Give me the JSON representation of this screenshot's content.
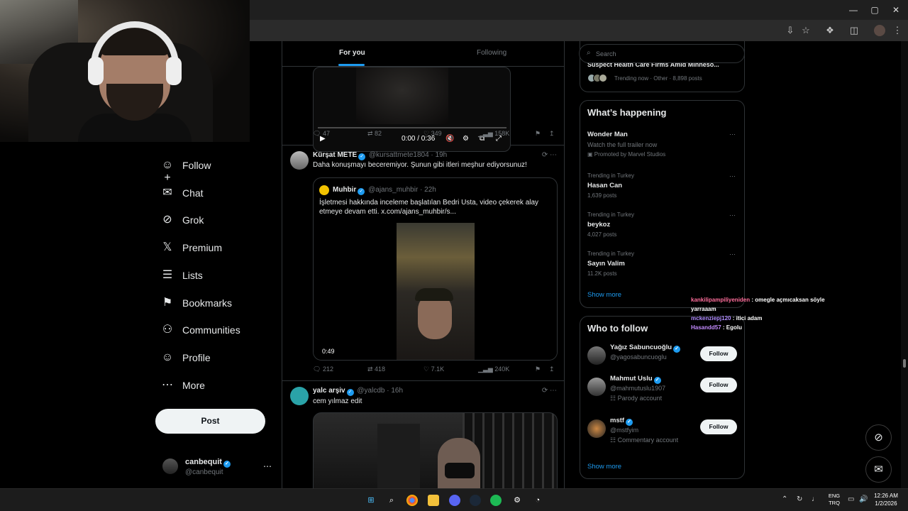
{
  "window": {
    "controls": [
      "—",
      "▢",
      "✕"
    ]
  },
  "nav": {
    "items": [
      {
        "label": "Follow",
        "icon": "follow-icon",
        "glyph": "☺+"
      },
      {
        "label": "Chat",
        "icon": "chat-icon",
        "glyph": "✉"
      },
      {
        "label": "Grok",
        "icon": "grok-icon",
        "glyph": "⊘"
      },
      {
        "label": "Premium",
        "icon": "x-logo-icon",
        "glyph": "𝕏"
      },
      {
        "label": "Lists",
        "icon": "lists-icon",
        "glyph": "☰"
      },
      {
        "label": "Bookmarks",
        "icon": "bookmark-icon",
        "glyph": "⚑"
      },
      {
        "label": "Communities",
        "icon": "communities-icon",
        "glyph": "⚇"
      },
      {
        "label": "Profile",
        "icon": "profile-icon",
        "glyph": "☺"
      },
      {
        "label": "More",
        "icon": "more-icon",
        "glyph": "⋯"
      }
    ],
    "post_label": "Post",
    "account": {
      "name": "canbequit",
      "handle": "@canbequit"
    }
  },
  "timeline": {
    "tabs": [
      "For you",
      "Following"
    ],
    "tweet1": {
      "video_time": "0:00 / 0:36",
      "replies": "47",
      "reposts": "82",
      "likes": "349",
      "views": "158K"
    },
    "tweet2": {
      "name": "Kürşat METE",
      "handle": "@kursattmete1804 · 19h",
      "text": "Daha konuşmayı beceremiyor. Şunun gibi itleri meşhur ediyorsunuz!",
      "quote": {
        "name": "Muhbir",
        "handle": "@ajans_muhbir · 22h",
        "text": "İşletmesi hakkında inceleme başlatılan Bedri Usta, video çekerek alay etmeye devam etti.  x.com/ajans_muhbir/s...",
        "duration": "0:49"
      },
      "replies": "212",
      "reposts": "418",
      "likes": "7.1K",
      "views": "240K"
    },
    "tweet3": {
      "name": "yalc arşiv",
      "handle": "@yalcdb · 16h",
      "text": "cem yılmaz edit"
    }
  },
  "right": {
    "search_placeholder": "Search",
    "top_trend": {
      "title": "Suspect Health Care Firms Amid Minneso...",
      "meta": "Trending now · Other · 8,898 posts"
    },
    "whats_happening": {
      "title": "What’s happening",
      "trends": [
        {
          "context": "",
          "name": "Wonder Man",
          "sub": "Watch the full trailer now",
          "promo": "Promoted by Marvel Studios"
        },
        {
          "context": "Trending in Turkey",
          "name": "Hasan Can",
          "sub": "1,639 posts"
        },
        {
          "context": "Trending in Turkey",
          "name": "beykoz",
          "sub": "4,027 posts"
        },
        {
          "context": "Trending in Turkey",
          "name": "Sayın Valim",
          "sub": "11.2K posts"
        }
      ],
      "show_more": "Show more"
    },
    "who_to_follow": {
      "title": "Who to follow",
      "people": [
        {
          "name": "Yağız Sabuncuoğlu",
          "handle": "@yagosabuncuoglu",
          "label": ""
        },
        {
          "name": "Mahmut Uslu",
          "handle": "@mahmutuslu1907",
          "label": "Parody account"
        },
        {
          "name": "mstf",
          "handle": "@mstfyim",
          "label": "Commentary account"
        }
      ],
      "follow_label": "Follow",
      "show_more": "Show more"
    }
  },
  "chat": [
    {
      "user": "kankilipampiliyeniden",
      "msg": "omegle açmıcaksan söyle yarraaam"
    },
    {
      "user": "mckenziepj120",
      "msg": "itici adam"
    },
    {
      "user": "Hasandd57",
      "msg": "Egolu"
    }
  ],
  "taskbar": {
    "lang": [
      "ENG",
      "TRQ"
    ],
    "time": "12:26 AM",
    "date": "1/2/2026"
  }
}
